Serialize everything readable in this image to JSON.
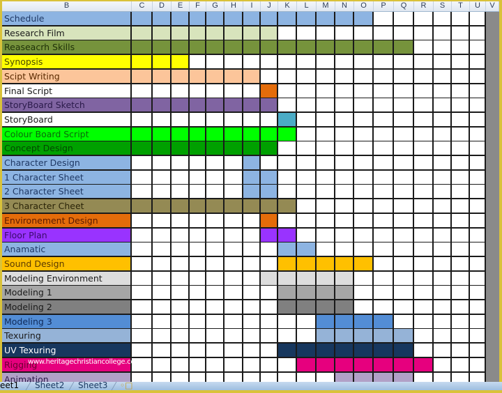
{
  "window": {
    "app": "Spreadsheet - Project Schedule Gantt"
  },
  "columns": [
    "B",
    "C",
    "D",
    "E",
    "F",
    "G",
    "H",
    "I",
    "J",
    "K",
    "L",
    "M",
    "N",
    "O",
    "P",
    "Q",
    "R",
    "S",
    "T",
    "U",
    "V"
  ],
  "timeline_columns": [
    "C",
    "D",
    "E",
    "F",
    "G",
    "H",
    "I",
    "J",
    "K",
    "L",
    "M",
    "N",
    "O",
    "P",
    "Q",
    "R",
    "S",
    "T",
    "U"
  ],
  "tasks": [
    {
      "label": "Schedule",
      "color": "#8db4e2",
      "text_color": "#1f3864",
      "start": "C",
      "end": "O"
    },
    {
      "label": "Research Film",
      "color": "#d8e4bc",
      "text_color": "#1a1a1a",
      "start": "C",
      "end": "J"
    },
    {
      "label": "Reaseacrh Skills",
      "color": "#76933c",
      "text_color": "#1e3008",
      "start": "C",
      "end": "Q"
    },
    {
      "label": "Synopsis",
      "color": "#ffff00",
      "text_color": "#4a4a00",
      "start": "C",
      "end": "E"
    },
    {
      "label": "Scipt Writing",
      "color": "#fcc59a",
      "text_color": "#5a2a00",
      "start": "C",
      "end": "I"
    },
    {
      "label": "Final Script",
      "color": "#ffffff",
      "text_color": "#1a1a1a",
      "start": "J",
      "end": "J",
      "bar_color": "#e46c0a"
    },
    {
      "label": "StoryBoard Sketch",
      "color": "#8064a2",
      "text_color": "#2a1a4a",
      "start": "C",
      "end": "J"
    },
    {
      "label": "StoryBoard",
      "color": "#ffffff",
      "text_color": "#1a1a1a",
      "start": "K",
      "end": "K",
      "bar_color": "#4bacc6"
    },
    {
      "label": "Colour Board Script",
      "color": "#00ff00",
      "text_color": "#0a6a0a",
      "start": "C",
      "end": "K"
    },
    {
      "label": "Concept Design",
      "color": "#00a000",
      "text_color": "#004a00",
      "start": "C",
      "end": "J"
    },
    {
      "label": "Character Design",
      "color": "#8db4e2",
      "text_color": "#1f3864",
      "start": "I",
      "end": "I"
    },
    {
      "label": "1 Character Sheet",
      "color": "#8db4e2",
      "text_color": "#1f3864",
      "start": "I",
      "end": "J"
    },
    {
      "label": "2 Character Sheet",
      "color": "#8db4e2",
      "text_color": "#1f3864",
      "start": "I",
      "end": "J"
    },
    {
      "label": "3 Character Cheet",
      "color": "#948a54",
      "text_color": "#2a2408",
      "start": "C",
      "end": "K"
    },
    {
      "label": "Environement Design",
      "color": "#e46c0a",
      "text_color": "#5a1a00",
      "start": "J",
      "end": "J"
    },
    {
      "label": "Floor Plan",
      "color": "#9933ff",
      "text_color": "#3a0a6a",
      "start": "J",
      "end": "K"
    },
    {
      "label": "Anamatic",
      "color": "#8db4e2",
      "text_color": "#1f3864",
      "start": "K",
      "end": "L"
    },
    {
      "label": "Sound Design",
      "color": "#ffc000",
      "text_color": "#5a3a00",
      "start": "K",
      "end": "O"
    },
    {
      "label": "Modeling Environment",
      "color": "#dddddd",
      "text_color": "#1a1a1a",
      "start": "J",
      "end": "N"
    },
    {
      "label": "Modeling 1",
      "color": "#a6a6a6",
      "text_color": "#1a1a1a",
      "start": "K",
      "end": "N"
    },
    {
      "label": "Modeling 2",
      "color": "#808080",
      "text_color": "#1a1a1a",
      "start": "K",
      "end": "N"
    },
    {
      "label": "Modeling 3",
      "color": "#538dd5",
      "text_color": "#0f2a5a",
      "start": "M",
      "end": "P"
    },
    {
      "label": "Texuring",
      "color": "#95b3d7",
      "text_color": "#1a1a1a",
      "start": "M",
      "end": "Q"
    },
    {
      "label": "UV Texuring",
      "color": "#17375e",
      "text_color": "#ffffff",
      "start": "K",
      "end": "Q"
    },
    {
      "label": "Rigging",
      "color": "#e6007e",
      "text_color": "#6a0030",
      "start": "L",
      "end": "R"
    },
    {
      "label": "Animation",
      "color": "#b1a0c7",
      "text_color": "#2a1a4a",
      "start": "N",
      "end": "Q"
    }
  ],
  "sheet_tabs": [
    {
      "label": "eet1",
      "active": true
    },
    {
      "label": "Sheet2",
      "active": false
    },
    {
      "label": "Sheet3",
      "active": false
    }
  ],
  "insert_sheet_icon": "insert-sheet-icon",
  "watermark": "www.heritagechristiancollege.com"
}
